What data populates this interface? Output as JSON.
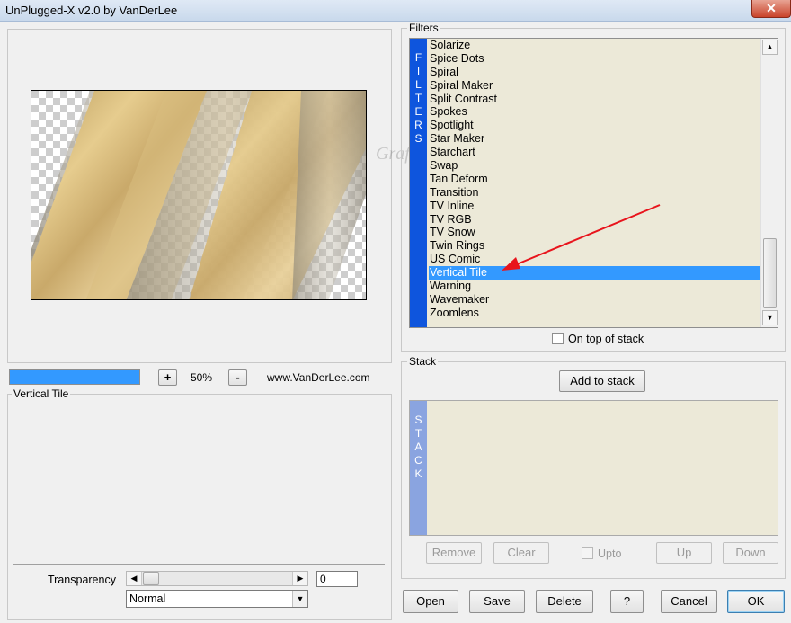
{
  "window": {
    "title": "UnPlugged-X v2.0 by VanDerLee",
    "close_glyph": "✕"
  },
  "preview": {
    "zoom_minus": "-",
    "zoom_plus": "+",
    "zoom_level": "50%",
    "website": "www.VanDerLee.com",
    "progress": 1.0,
    "watermark": "Graficoamoria"
  },
  "settings": {
    "filter_name": "Vertical Tile",
    "transparency_label": "Transparency",
    "transparency_value": "0",
    "blend_mode": "Normal"
  },
  "filters": {
    "group_label": "Filters",
    "side_letters": [
      "F",
      "I",
      "L",
      "T",
      "E",
      "R",
      "S"
    ],
    "items": [
      "Solarize",
      "Spice Dots",
      "Spiral",
      "Spiral Maker",
      "Split Contrast",
      "Spokes",
      "Spotlight",
      "Star Maker",
      "Starchart",
      "Swap",
      "Tan Deform",
      "Transition",
      "TV Inline",
      "TV RGB",
      "TV Snow",
      "Twin Rings",
      "US Comic",
      "Vertical Tile",
      "Warning",
      "Wavemaker",
      "Zoomlens"
    ],
    "selected": "Vertical Tile",
    "on_top_label": "On top of stack"
  },
  "stack": {
    "group_label": "Stack",
    "add_label": "Add to stack",
    "side_letters": [
      "S",
      "T",
      "A",
      "C",
      "K"
    ],
    "remove_label": "Remove",
    "clear_label": "Clear",
    "upto_label": "Upto",
    "up_label": "Up",
    "down_label": "Down"
  },
  "buttons": {
    "open": "Open",
    "save": "Save",
    "delete": "Delete",
    "help": "?",
    "cancel": "Cancel",
    "ok": "OK"
  },
  "colors": {
    "filter_sidebar": "#0e55dd",
    "selection": "#3399ff",
    "list_bg": "#ece9d8",
    "stack_sidebar": "#8aa4e0"
  }
}
